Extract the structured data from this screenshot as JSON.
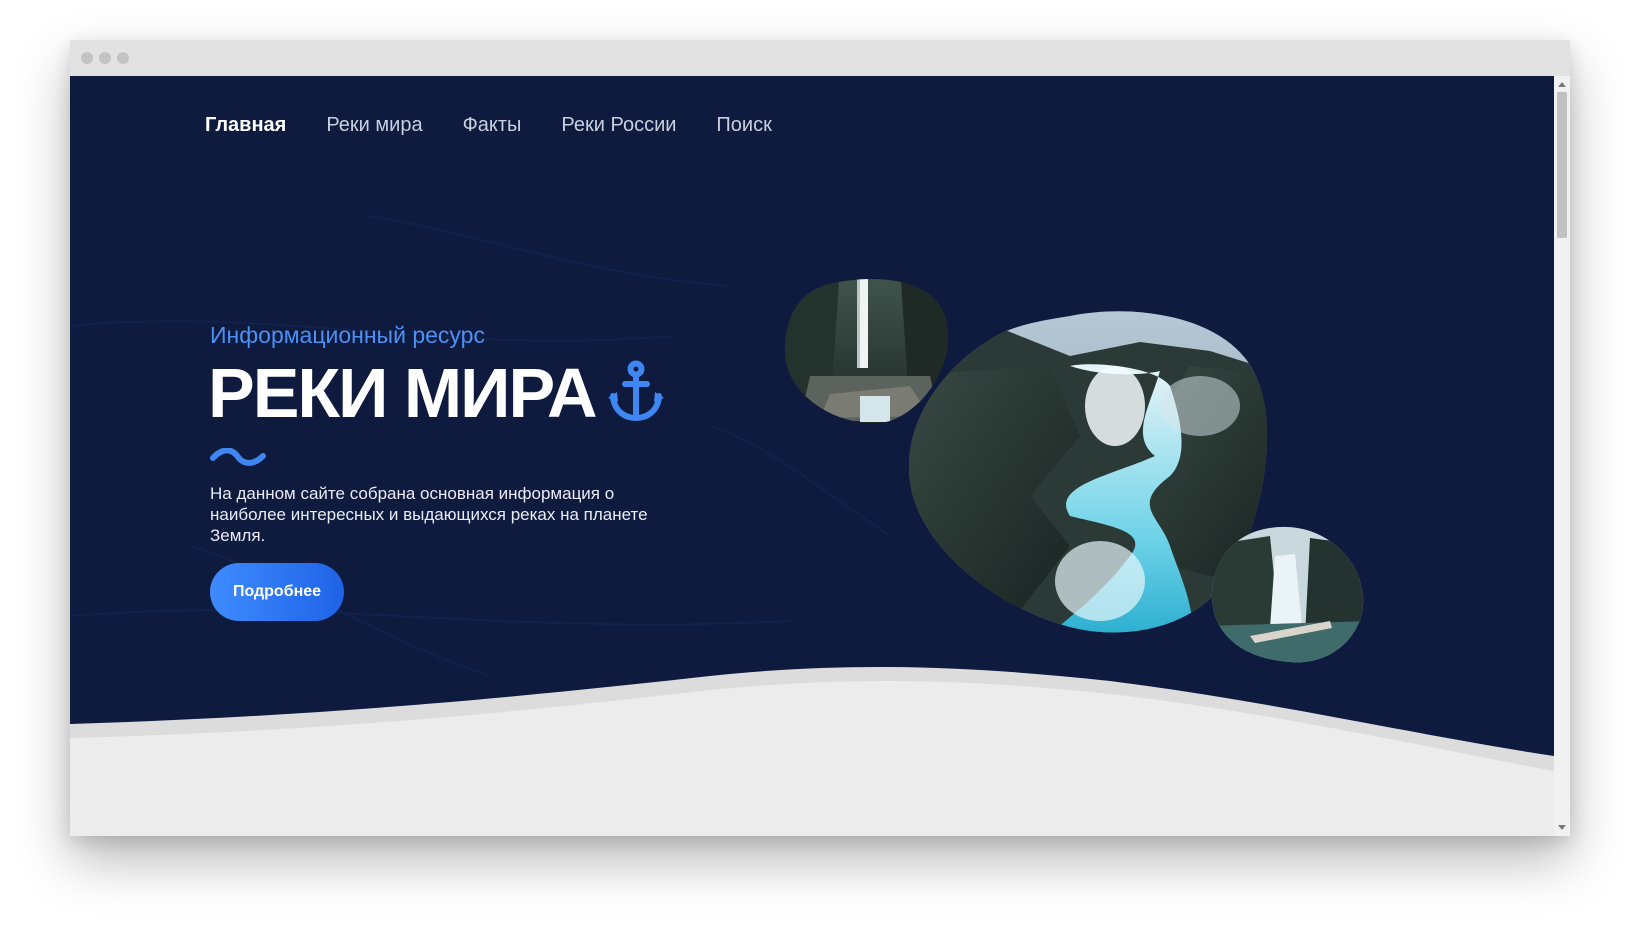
{
  "nav": {
    "items": [
      {
        "label": "Главная",
        "active": true
      },
      {
        "label": "Реки мира",
        "active": false
      },
      {
        "label": "Факты",
        "active": false
      },
      {
        "label": "Реки России",
        "active": false
      },
      {
        "label": "Поиск",
        "active": false
      }
    ]
  },
  "hero": {
    "subtitle": "Информационный ресурс",
    "title": "РЕКИ МИРА",
    "title_icon": "anchor-icon",
    "description": "На данном сайте собрана основная информация о наиболее интересных и выдающихся реках на планете Земля.",
    "button_label": "Подробнее"
  },
  "photos": [
    {
      "name": "waterfall-photo-small-top",
      "icon": "waterfall-image"
    },
    {
      "name": "waterfall-photo-large",
      "icon": "waterfall-image"
    },
    {
      "name": "waterfall-photo-small-bottom",
      "icon": "waterfall-image"
    }
  ],
  "colors": {
    "background": "#0e1b3f",
    "accent": "#4c8ff5",
    "button": "#2a76f5",
    "footer_wave": "#ececec"
  }
}
